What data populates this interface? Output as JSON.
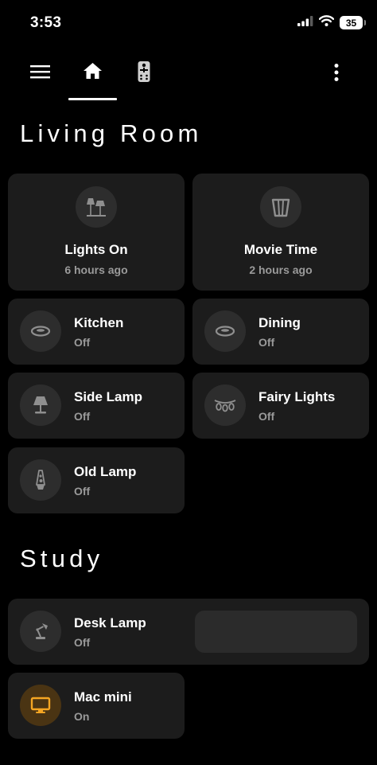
{
  "status_bar": {
    "time": "3:53",
    "battery_level": "35",
    "icons": [
      "signal-icon",
      "wifi-icon",
      "battery-icon"
    ]
  },
  "toolbar": {
    "icons": [
      "menu-icon",
      "home-icon",
      "remote-icon",
      "more-vert-icon"
    ],
    "active_tab": "home"
  },
  "sections": {
    "living_room": {
      "title": "Living Room",
      "cards": [
        {
          "name": "Lights On",
          "state": "6 hours ago",
          "icon": "floor-lamp-icon"
        },
        {
          "name": "Movie Time",
          "state": "2 hours ago",
          "icon": "popcorn-icon"
        },
        {
          "name": "Kitchen",
          "state": "Off",
          "icon": "ceiling-light-icon"
        },
        {
          "name": "Dining",
          "state": "Off",
          "icon": "ceiling-light-icon"
        },
        {
          "name": "Side Lamp",
          "state": "Off",
          "icon": "table-lamp-icon"
        },
        {
          "name": "Fairy Lights",
          "state": "Off",
          "icon": "string-lights-icon"
        },
        {
          "name": "Old Lamp",
          "state": "Off",
          "icon": "lava-lamp-icon"
        }
      ]
    },
    "study": {
      "title": "Study",
      "cards": [
        {
          "name": "Desk Lamp",
          "state": "Off",
          "icon": "desk-lamp-icon"
        },
        {
          "name": "Mac mini",
          "state": "On",
          "icon": "monitor-icon"
        }
      ]
    }
  },
  "colors": {
    "background": "#000000",
    "card": "#1c1c1c",
    "icon_circle": "#2d2d2d",
    "icon_gray": "#8f8f8f",
    "secondary_text": "#9a9a9a",
    "on_accent": "#f5a623",
    "on_circle": "#4a3413"
  }
}
